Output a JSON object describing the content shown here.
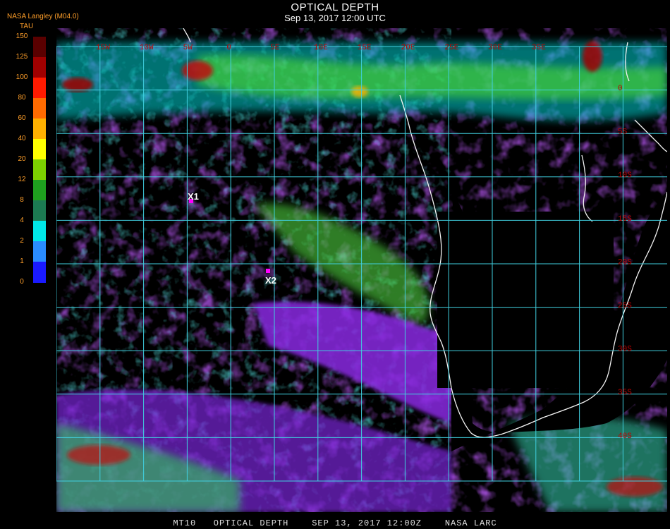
{
  "header": {
    "title": "OPTICAL DEPTH",
    "datetime": "Sep 13, 2017 12:00 UTC",
    "brand": "NASA Langley (M04.0)"
  },
  "colorbar": {
    "title": "TAU",
    "labels": [
      "150",
      "125",
      "100",
      "80",
      "60",
      "40",
      "20",
      "12",
      "8",
      "4",
      "2",
      "1",
      "0"
    ],
    "colors": [
      "#5a0000",
      "#a00000",
      "#ff1a00",
      "#ff6a00",
      "#ffb000",
      "#ffff00",
      "#7cd000",
      "#1fa01f",
      "#1c7a52",
      "#00e8e8",
      "#2a8cff",
      "#1a1aff",
      "#8a2be2"
    ]
  },
  "map": {
    "grid_color": "#40d0e0",
    "label_color": "#c00000",
    "lon_labels": [
      "15W",
      "10W",
      "5W",
      "0",
      "5E",
      "10E",
      "15E",
      "20E",
      "25E",
      "30E",
      "35E"
    ],
    "lat_labels": [
      "0",
      "5S",
      "10S",
      "15S",
      "20S",
      "25S",
      "30S",
      "35S",
      "40S"
    ],
    "markers": [
      {
        "label": "X1",
        "color": "#ff00ff"
      },
      {
        "label": "X2",
        "color": "#ff00ff"
      }
    ]
  },
  "footer": "MT10   OPTICAL DEPTH    SEP 13, 2017 12:00Z    NASA LARC"
}
